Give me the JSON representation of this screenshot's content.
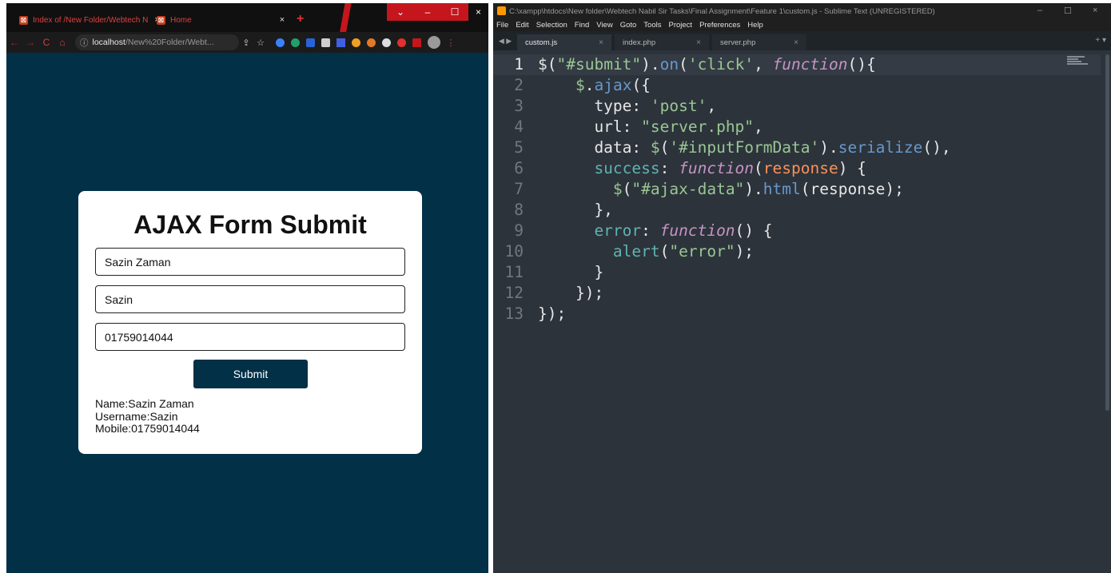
{
  "browser": {
    "tabs": [
      {
        "title": "Index of /New Folder/Webtech N",
        "close": "×"
      },
      {
        "title": "Home",
        "close": "×"
      }
    ],
    "new_tab": "+",
    "window_controls": {
      "dropdown": "⌄",
      "minimize": "–",
      "maximize": "☐",
      "close": "×"
    },
    "nav": {
      "back": "←",
      "forward": "→",
      "reload": "C",
      "home": "⌂"
    },
    "address": {
      "info": "ⓘ",
      "host": "localhost",
      "path": "/New%20Folder/Webt..."
    },
    "toolbar_icons": {
      "share": "⇪",
      "bookmark": "☆",
      "menu": "⋮"
    }
  },
  "form": {
    "title": "AJAX Form Submit",
    "fields": {
      "name": "Sazin Zaman",
      "username": "Sazin",
      "mobile": "01759014044"
    },
    "submit_label": "Submit",
    "result": {
      "name": "Name:Sazin Zaman",
      "username": "Username:Sazin",
      "mobile": "Mobile:01759014044"
    }
  },
  "editor": {
    "title": "C:\\xampp\\htdocs\\New folder\\Webtech Nabil Sir Tasks\\Final Assignment\\Feature 1\\custom.js - Sublime Text (UNREGISTERED)",
    "window_controls": {
      "minimize": "–",
      "maximize": "☐",
      "close": "×"
    },
    "menu": [
      "File",
      "Edit",
      "Selection",
      "Find",
      "View",
      "Goto",
      "Tools",
      "Project",
      "Preferences",
      "Help"
    ],
    "tab_arrows": "◀ ▶",
    "tabs": [
      {
        "name": "custom.js",
        "close": "×",
        "active": true
      },
      {
        "name": "index.php",
        "close": "×",
        "active": false
      },
      {
        "name": "server.php",
        "close": "×",
        "active": false
      }
    ],
    "tab_menu": "+ ▾",
    "current_line": 1,
    "code_lines": [
      [
        {
          "t": "$",
          "c": "w"
        },
        {
          "t": "(",
          "c": "w"
        },
        {
          "t": "\"#submit\"",
          "c": "s"
        },
        {
          "t": ").",
          "c": "w"
        },
        {
          "t": "on",
          "c": "f"
        },
        {
          "t": "(",
          "c": "w"
        },
        {
          "t": "'click'",
          "c": "s"
        },
        {
          "t": ", ",
          "c": "w"
        },
        {
          "t": "function",
          "c": "k"
        },
        {
          "t": "(){",
          "c": "w"
        }
      ],
      [
        {
          "t": "    ",
          "c": "w"
        },
        {
          "t": "$",
          "c": "s"
        },
        {
          "t": ".",
          "c": "w"
        },
        {
          "t": "ajax",
          "c": "f"
        },
        {
          "t": "({",
          "c": "w"
        }
      ],
      [
        {
          "t": "      type",
          "c": "w"
        },
        {
          "t": ": ",
          "c": "w"
        },
        {
          "t": "'post'",
          "c": "s"
        },
        {
          "t": ",",
          "c": "w"
        }
      ],
      [
        {
          "t": "      url",
          "c": "w"
        },
        {
          "t": ": ",
          "c": "w"
        },
        {
          "t": "\"server.php\"",
          "c": "s"
        },
        {
          "t": ",",
          "c": "w"
        }
      ],
      [
        {
          "t": "      data",
          "c": "w"
        },
        {
          "t": ": ",
          "c": "w"
        },
        {
          "t": "$",
          "c": "s"
        },
        {
          "t": "(",
          "c": "w"
        },
        {
          "t": "'#inputFormData'",
          "c": "s"
        },
        {
          "t": ").",
          "c": "w"
        },
        {
          "t": "serialize",
          "c": "f"
        },
        {
          "t": "(),",
          "c": "w"
        }
      ],
      [
        {
          "t": "      success",
          "c": "p"
        },
        {
          "t": ": ",
          "c": "w"
        },
        {
          "t": "function",
          "c": "k"
        },
        {
          "t": "(",
          "c": "w"
        },
        {
          "t": "response",
          "c": "o"
        },
        {
          "t": ") {",
          "c": "w"
        }
      ],
      [
        {
          "t": "        ",
          "c": "w"
        },
        {
          "t": "$",
          "c": "s"
        },
        {
          "t": "(",
          "c": "w"
        },
        {
          "t": "\"#ajax-data\"",
          "c": "s"
        },
        {
          "t": ").",
          "c": "w"
        },
        {
          "t": "html",
          "c": "f"
        },
        {
          "t": "(response);",
          "c": "w"
        }
      ],
      [
        {
          "t": "      },",
          "c": "w"
        }
      ],
      [
        {
          "t": "      error",
          "c": "p"
        },
        {
          "t": ": ",
          "c": "w"
        },
        {
          "t": "function",
          "c": "k"
        },
        {
          "t": "() {",
          "c": "w"
        }
      ],
      [
        {
          "t": "        ",
          "c": "w"
        },
        {
          "t": "alert",
          "c": "p"
        },
        {
          "t": "(",
          "c": "w"
        },
        {
          "t": "\"error\"",
          "c": "s"
        },
        {
          "t": ");",
          "c": "w"
        }
      ],
      [
        {
          "t": "      }",
          "c": "w"
        }
      ],
      [
        {
          "t": "    });",
          "c": "w"
        }
      ],
      [
        {
          "t": "});",
          "c": "w"
        }
      ]
    ]
  },
  "colors": {
    "page_bg": "#023047",
    "button_bg": "#023047",
    "editor_bg": "#2d333b",
    "browser_accent": "#c4161c"
  }
}
